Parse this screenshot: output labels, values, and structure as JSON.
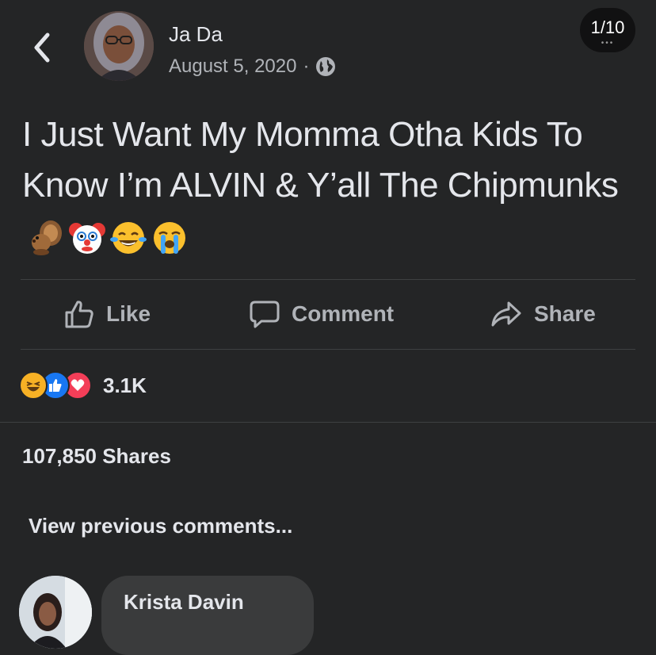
{
  "header": {
    "author": "Ja Da",
    "date": "August 5, 2020",
    "separator": "·",
    "privacy_icon": "globe-icon",
    "counter": "1/10",
    "counter_dots": "•••"
  },
  "post": {
    "text": "I Just Want My Momma Otha Kids To Know I’m ALVIN & Y’all The Chipmunks",
    "emojis": [
      "chipmunk",
      "clown-face",
      "face-with-tears-of-joy",
      "loudly-crying-face"
    ]
  },
  "actions": {
    "like": "Like",
    "comment": "Comment",
    "share": "Share"
  },
  "reactions": {
    "icons": [
      "haha-reaction",
      "like-reaction",
      "love-reaction"
    ],
    "count": "3.1K"
  },
  "shares": "107,850 Shares",
  "comments": {
    "view_previous": "View previous comments...",
    "first_commenter": "Krista Davin"
  },
  "colors": {
    "background": "#242526",
    "text": "#e4e6eb",
    "secondary_text": "#b0b3b8",
    "bubble": "#3a3b3c",
    "like_blue": "#1877f2",
    "love_red": "#f33e58",
    "haha_yellow": "#f7b125"
  }
}
